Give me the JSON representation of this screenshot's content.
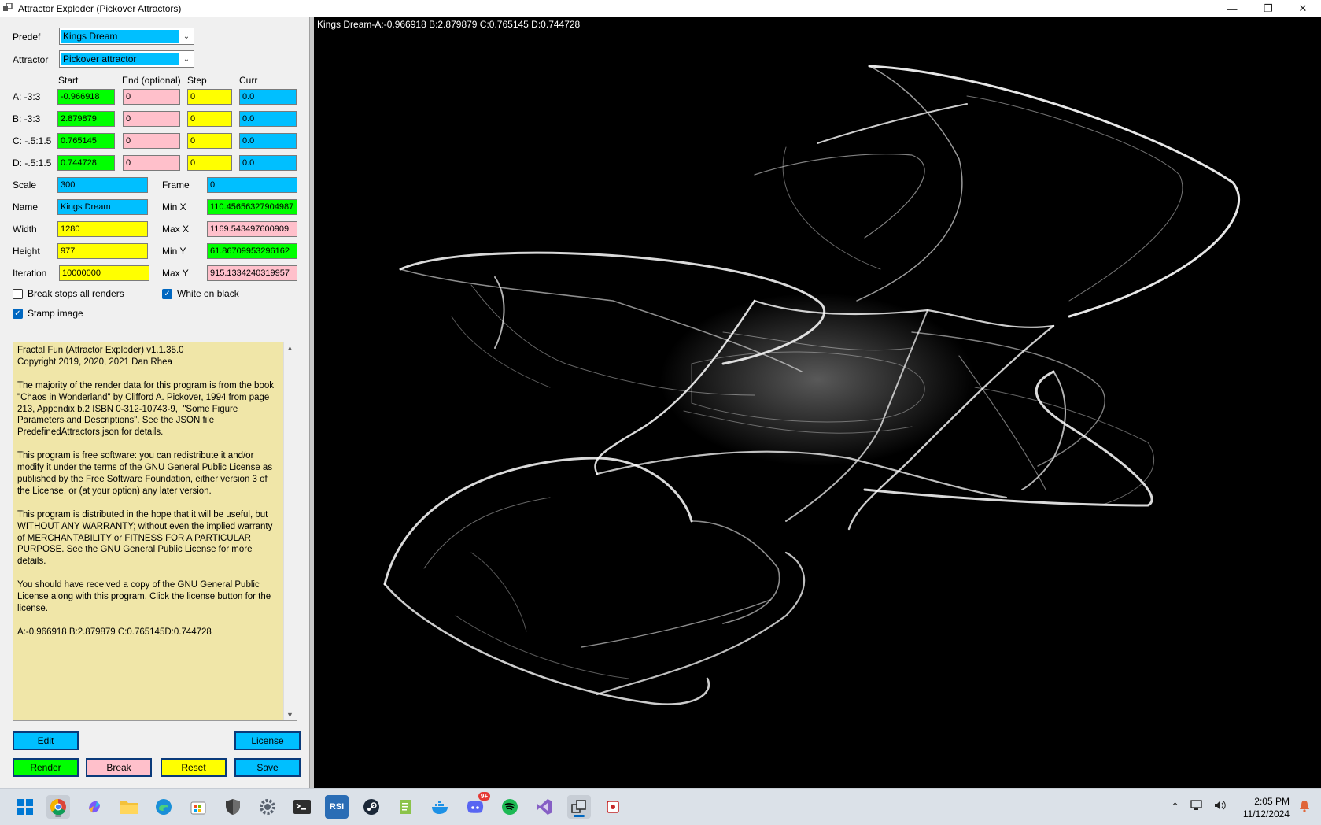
{
  "window": {
    "title": "Attractor Exploder (Pickover Attractors)",
    "minimize_glyph": "—",
    "restore_glyph": "❐",
    "close_glyph": "✕"
  },
  "controls": {
    "predef_label": "Predef",
    "predef_value": "Kings Dream",
    "attractor_label": "Attractor",
    "attractor_value": "Pickover attractor",
    "col_start": "Start",
    "col_end": "End (optional)",
    "col_step": "Step",
    "col_curr": "Curr",
    "params": [
      {
        "label": "A: -3:3",
        "start": "-0.966918",
        "end": "0",
        "step": "0",
        "curr": "0.0"
      },
      {
        "label": "B: -3:3",
        "start": "2.879879",
        "end": "0",
        "step": "0",
        "curr": "0.0"
      },
      {
        "label": "C: -.5:1.5",
        "start": "0.765145",
        "end": "0",
        "step": "0",
        "curr": "0.0"
      },
      {
        "label": "D: -.5:1.5",
        "start": "0.744728",
        "end": "0",
        "step": "0",
        "curr": "0.0"
      }
    ],
    "scale_label": "Scale",
    "scale_value": "300",
    "frame_label": "Frame",
    "frame_value": "0",
    "name_label": "Name",
    "name_value": "Kings Dream",
    "minx_label": "Min X",
    "minx_value": "110.45656327904987",
    "width_label": "Width",
    "width_value": "1280",
    "maxx_label": "Max X",
    "maxx_value": "1169.543497600909",
    "height_label": "Height",
    "height_value": "977",
    "miny_label": "Min Y",
    "miny_value": "61.86709953296162",
    "iteration_label": "Iteration",
    "iteration_value": "10000000",
    "maxy_label": "Max Y",
    "maxy_value": "915.1334240319957",
    "break_stops_label": "Break stops all renders",
    "break_stops_checked": false,
    "white_on_black_label": "White on black",
    "white_on_black_checked": true,
    "stamp_image_label": "Stamp image",
    "stamp_image_checked": true
  },
  "about_text": "Fractal Fun (Attractor Exploder) v1.1.35.0\nCopyright 2019, 2020, 2021 Dan Rhea\n\nThe majority of the render data for this program is from the book \"Chaos in Wonderland\" by Clifford A. Pickover, 1994 from page 213, Appendix b.2 ISBN 0-312-10743-9,  \"Some Figure Parameters and Descriptions\". See the JSON file PredefinedAttractors.json for details.\n\nThis program is free software: you can redistribute it and/or modify it under the terms of the GNU General Public License as published by the Free Software Foundation, either version 3 of the License, or (at your option) any later version.\n\nThis program is distributed in the hope that it will be useful, but WITHOUT ANY WARRANTY; without even the implied warranty of MERCHANTABILITY or FITNESS FOR A PARTICULAR PURPOSE. See the GNU General Public License for more details.\n\nYou should have received a copy of the GNU General Public License along with this program. Click the license button for the license.\n\nA:-0.966918 B:2.879879 C:0.765145D:0.744728",
  "buttons": {
    "edit": "Edit",
    "license": "License",
    "render": "Render",
    "break": "Break",
    "reset": "Reset",
    "save": "Save"
  },
  "canvas": {
    "stamp": "Kings Dream-A:-0.966918 B:2.879879 C:0.765145 D:0.744728"
  },
  "taskbar": {
    "time": "2:05 PM",
    "date": "11/12/2024",
    "discord_badge": "9+"
  },
  "colors": {
    "green": "#00ff00",
    "pink": "#ffc0cb",
    "yellow": "#ffff00",
    "blue": "#00bfff",
    "about_bg": "#f0e6a8"
  }
}
